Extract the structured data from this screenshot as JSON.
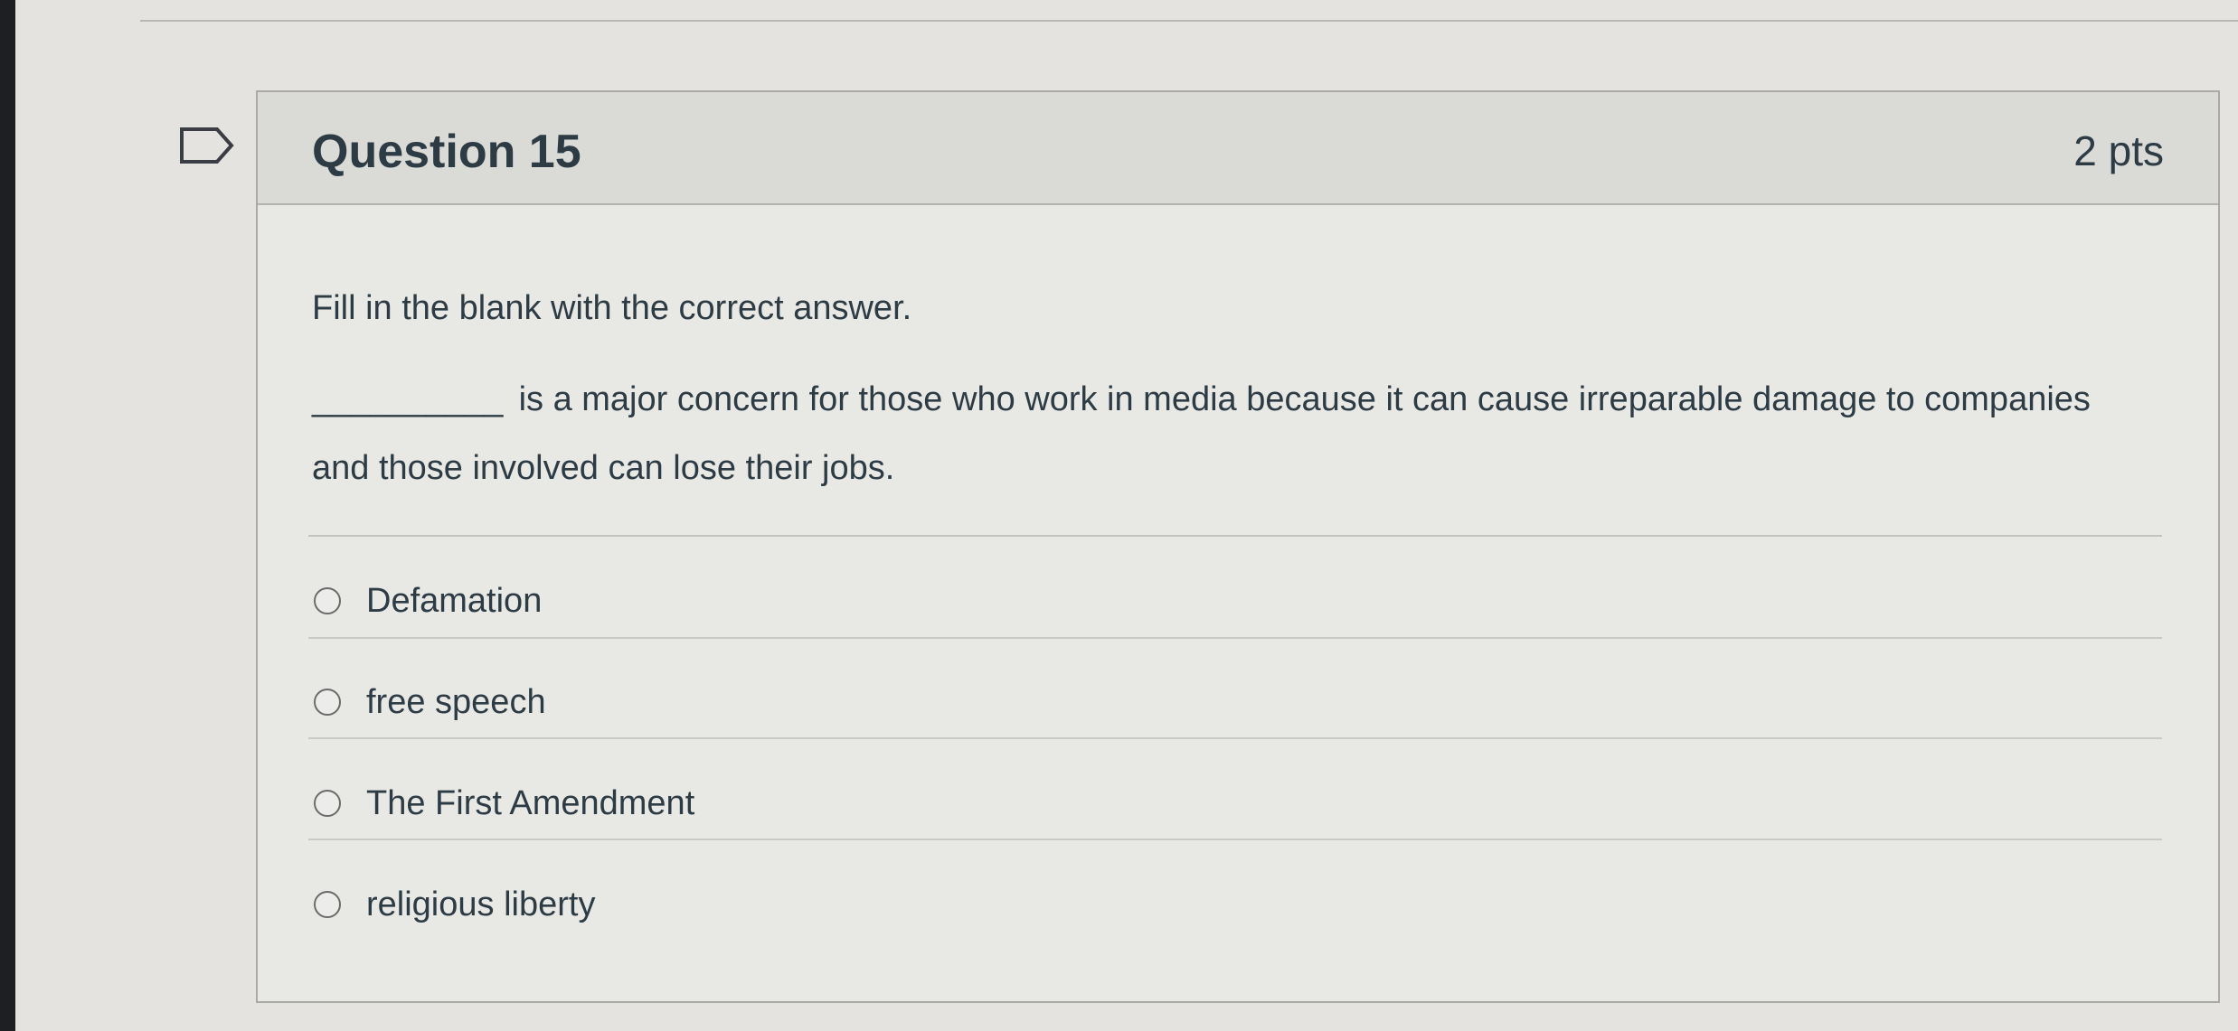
{
  "question": {
    "title": "Question 15",
    "points": "2 pts",
    "instruction": "Fill in the blank with the correct answer.",
    "blank": "__________",
    "text": "is a major concern for those who work in media because it can cause irreparable damage to companies and those involved can lose their jobs."
  },
  "answers": [
    {
      "label": "Defamation"
    },
    {
      "label": "free speech"
    },
    {
      "label": "The First Amendment"
    },
    {
      "label": "religious liberty"
    }
  ],
  "colors": {
    "text": "#2d3b45",
    "header_bg": "#dadad6",
    "card_bg": "#e8e8e4",
    "border": "#a9a9a6"
  },
  "icons": {
    "flag": "flag-icon",
    "radio": "radio-icon"
  }
}
